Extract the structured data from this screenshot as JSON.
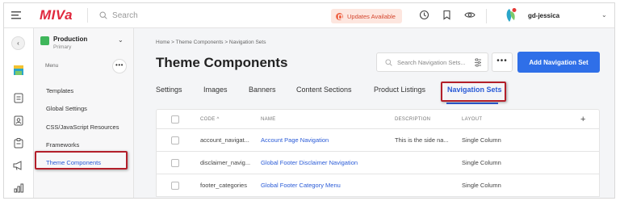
{
  "topbar": {
    "logo": "MIVa",
    "search_placeholder": "Search",
    "updates_label": "Updates Available",
    "username": "gd-jessica"
  },
  "store": {
    "name": "Production",
    "subtitle": "Primary",
    "menu_label": "Menu"
  },
  "sidebar": {
    "items": [
      {
        "label": "Templates"
      },
      {
        "label": "Global Settings"
      },
      {
        "label": "CSS/JavaScript Resources"
      },
      {
        "label": "Frameworks"
      },
      {
        "label": "Theme Components",
        "active": true
      }
    ]
  },
  "main": {
    "breadcrumb": "Home  >  Theme Components  >  Navigation Sets",
    "title": "Theme Components",
    "search_placeholder": "Search Navigation Sets...",
    "add_button": "Add Navigation Set",
    "tabs": [
      {
        "label": "Settings"
      },
      {
        "label": "Images"
      },
      {
        "label": "Banners"
      },
      {
        "label": "Content Sections"
      },
      {
        "label": "Product Listings"
      },
      {
        "label": "Navigation Sets",
        "active": true
      }
    ]
  },
  "table": {
    "headers": {
      "code": "CODE ^",
      "name": "NAME",
      "description": "DESCRIPTION",
      "layout": "LAYOUT"
    },
    "rows": [
      {
        "code": "account_navigat...",
        "name": "Account Page Navigation",
        "description": "This is the side na...",
        "layout": "Single Column"
      },
      {
        "code": "disclaimer_navig...",
        "name": "Global Footer Disclaimer Navigation",
        "description": "",
        "layout": "Single Column"
      },
      {
        "code": "footer_categories",
        "name": "Global Footer Category Menu",
        "description": "",
        "layout": "Single Column"
      }
    ]
  },
  "colors": {
    "accent": "#2f6fe8",
    "highlight": "#b31f2a",
    "brand": "#e0283d",
    "store_status": "#3fb65b"
  }
}
